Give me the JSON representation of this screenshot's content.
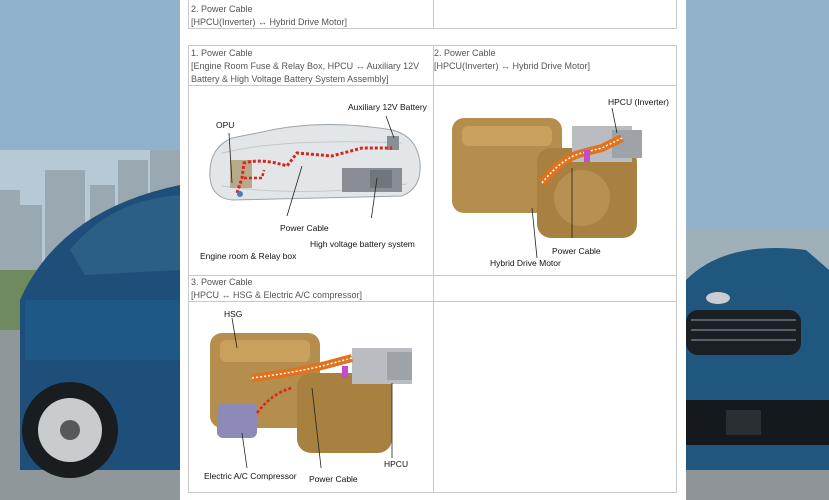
{
  "top_row": {
    "line1": "2. Power Cable",
    "line2": "[HPCU(Inverter) ↔ Hybrid Drive Motor]"
  },
  "table": {
    "cell1": {
      "title": "1. Power Cable",
      "line2": "[Engine Room Fuse & Relay Box, HPCU ↔ Auxiliary 12V",
      "line3": "Battery & High Voltage Battery System Assembly]"
    },
    "cell2": {
      "title": "2. Power Cable",
      "line2": "[HPCU(Inverter) ↔ Hybrid Drive Motor]"
    },
    "cell3": {
      "title": "3. Power Cable",
      "line2": "[HPCU ↔ HSG & Electric A/C compressor]"
    }
  },
  "diagram1": {
    "opu": "OPU",
    "aux_battery": "Auxiliary 12V Battery",
    "power_cable": "Power Cable",
    "hv_battery": "High voltage battery system",
    "engine_room": "Engine room & Relay box"
  },
  "diagram2": {
    "hpcu": "HPCU (Inverter)",
    "power_cable": "Power Cable",
    "motor": "Hybrid Drive Motor"
  },
  "diagram3": {
    "hsg": "HSG",
    "hpcu": "HPCU",
    "compressor": "Electric A/C Compressor",
    "power_cable": "Power Cable"
  }
}
